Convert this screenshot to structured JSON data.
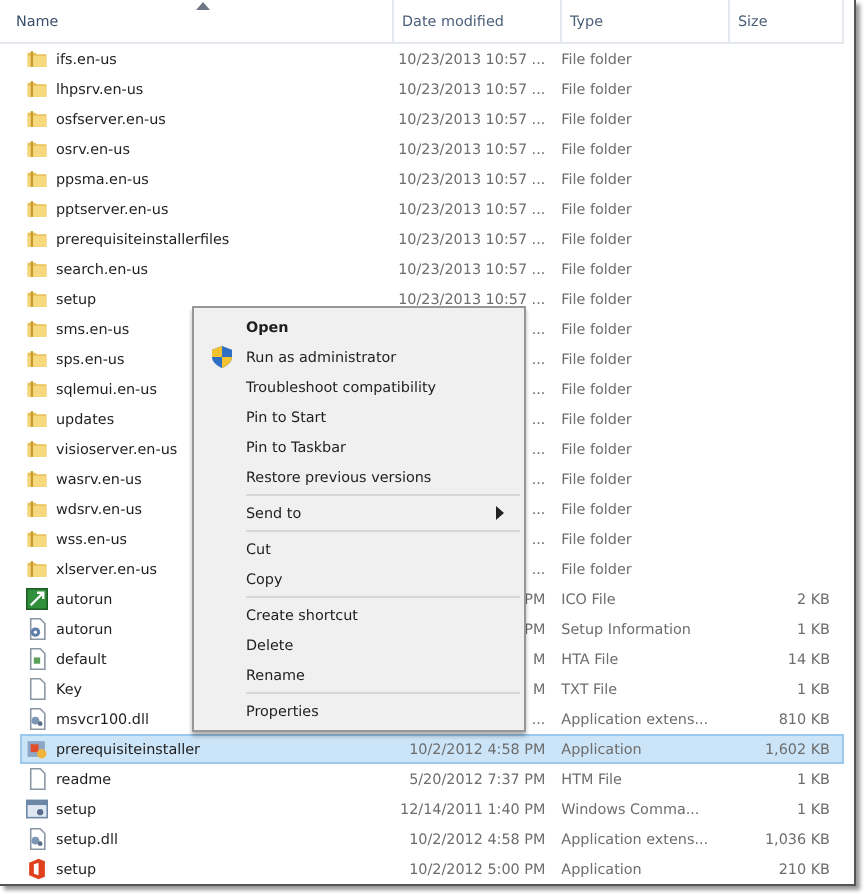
{
  "columns": [
    {
      "label": "Name",
      "sorted": true
    },
    {
      "label": "Date modified",
      "sorted": false
    },
    {
      "label": "Type",
      "sorted": false
    },
    {
      "label": "Size",
      "sorted": false
    }
  ],
  "rows": [
    {
      "kind": "folder",
      "name": "ifs.en-us",
      "date": "10/23/2013 10:57 ...",
      "type": "File folder",
      "selected": false
    },
    {
      "kind": "folder",
      "name": "lhpsrv.en-us",
      "date": "10/23/2013 10:57 ...",
      "type": "File folder",
      "selected": false
    },
    {
      "kind": "folder",
      "name": "osfserver.en-us",
      "date": "10/23/2013 10:57 ...",
      "type": "File folder",
      "selected": false
    },
    {
      "kind": "folder",
      "name": "osrv.en-us",
      "date": "10/23/2013 10:57 ...",
      "type": "File folder",
      "selected": false
    },
    {
      "kind": "folder",
      "name": "ppsma.en-us",
      "date": "10/23/2013 10:57 ...",
      "type": "File folder",
      "selected": false
    },
    {
      "kind": "folder",
      "name": "pptserver.en-us",
      "date": "10/23/2013 10:57 ...",
      "type": "File folder",
      "selected": false
    },
    {
      "kind": "folder",
      "name": "prerequisiteinstallerfiles",
      "date": "10/23/2013 10:57 ...",
      "type": "File folder",
      "selected": false
    },
    {
      "kind": "folder",
      "name": "search.en-us",
      "date": "10/23/2013 10:57 ...",
      "type": "File folder",
      "selected": false
    },
    {
      "kind": "folder",
      "name": "setup",
      "date": "10/23/2013 10:57 ...",
      "type": "File folder",
      "selected": false
    },
    {
      "kind": "folder",
      "name": "sms.en-us",
      "date": "...",
      "type": "File folder",
      "selected": false
    },
    {
      "kind": "folder",
      "name": "sps.en-us",
      "date": "...",
      "type": "File folder",
      "selected": false
    },
    {
      "kind": "folder",
      "name": "sqlemui.en-us",
      "date": "...",
      "type": "File folder",
      "selected": false
    },
    {
      "kind": "folder",
      "name": "updates",
      "date": "...",
      "type": "File folder",
      "selected": false
    },
    {
      "kind": "folder",
      "name": "visioserver.en-us",
      "date": "...",
      "type": "File folder",
      "selected": false
    },
    {
      "kind": "folder",
      "name": "wasrv.en-us",
      "date": "...",
      "type": "File folder",
      "selected": false
    },
    {
      "kind": "folder",
      "name": "wdsrv.en-us",
      "date": "...",
      "type": "File folder",
      "selected": false
    },
    {
      "kind": "folder",
      "name": "wss.en-us",
      "date": "...",
      "type": "File folder",
      "selected": false
    },
    {
      "kind": "folder",
      "name": "xlserver.en-us",
      "date": "...",
      "type": "File folder",
      "selected": false
    },
    {
      "kind": "image",
      "name": "autorun",
      "date": "PM",
      "type": "ICO File",
      "size": "2 KB",
      "selected": false
    },
    {
      "kind": "settings",
      "name": "autorun",
      "date": "PM",
      "type": "Setup Information",
      "size": "1 KB",
      "selected": false
    },
    {
      "kind": "page",
      "name": "default",
      "date": "M",
      "type": "HTA File",
      "size": "14 KB",
      "selected": false
    },
    {
      "kind": "blank",
      "name": "Key",
      "date": "M",
      "type": "TXT File",
      "size": "1 KB",
      "selected": false
    },
    {
      "kind": "library",
      "name": "msvcr100.dll",
      "date": "...",
      "type": "Application extens...",
      "size": "810 KB",
      "selected": false
    },
    {
      "kind": "installer",
      "name": "prerequisiteinstaller",
      "date": "10/2/2012 4:58 PM",
      "type": "Application",
      "size": "1,602 KB",
      "selected": true
    },
    {
      "kind": "blank",
      "name": "readme",
      "date": "5/20/2012 7:37 PM",
      "type": "HTM File",
      "size": "1 KB",
      "selected": false
    },
    {
      "kind": "window",
      "name": "setup",
      "date": "12/14/2011 1:40 PM",
      "type": "Windows Comma...",
      "size": "1 KB",
      "selected": false
    },
    {
      "kind": "library",
      "name": "setup.dll",
      "date": "10/2/2012 4:58 PM",
      "type": "Application extens...",
      "size": "1,036 KB",
      "selected": false
    },
    {
      "kind": "office",
      "name": "setup",
      "date": "10/2/2012 5:00 PM",
      "type": "Application",
      "size": "210 KB",
      "selected": false
    }
  ],
  "context_menu": {
    "items": [
      {
        "kind": "default",
        "label": "Open"
      },
      {
        "kind": "admin",
        "label": "Run as administrator"
      },
      {
        "kind": "item",
        "label": "Troubleshoot compatibility"
      },
      {
        "kind": "item",
        "label": "Pin to Start"
      },
      {
        "kind": "item",
        "label": "Pin to Taskbar"
      },
      {
        "kind": "item",
        "label": "Restore previous versions"
      },
      {
        "kind": "separator"
      },
      {
        "kind": "submenu",
        "label": "Send to"
      },
      {
        "kind": "separator"
      },
      {
        "kind": "item",
        "label": "Cut"
      },
      {
        "kind": "item",
        "label": "Copy"
      },
      {
        "kind": "separator"
      },
      {
        "kind": "item",
        "label": "Create shortcut"
      },
      {
        "kind": "item",
        "label": "Delete"
      },
      {
        "kind": "item",
        "label": "Rename"
      },
      {
        "kind": "separator"
      },
      {
        "kind": "item",
        "label": "Properties"
      }
    ]
  }
}
